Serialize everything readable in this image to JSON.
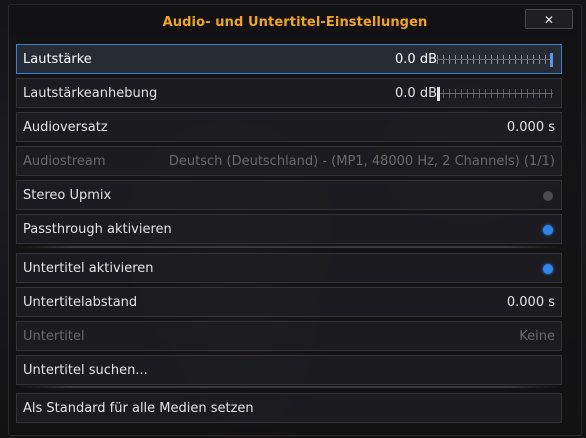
{
  "dialog": {
    "title": "Audio- und Untertitel-Einstellungen",
    "close_label": "✕"
  },
  "rows": [
    {
      "label": "Lautstärke",
      "value": "0.0 dB",
      "slider_level": 1.0
    },
    {
      "label": "Lautstärkeanhebung",
      "value": "0.0 dB",
      "slider_level": 0.0
    },
    {
      "label": "Audioversatz",
      "value": "0.000 s"
    },
    {
      "label": "Audiostream",
      "value": "Deutsch (Deutschland) - (MP1, 48000 Hz, 2 Channels) (1/1)"
    },
    {
      "label": "Stereo Upmix",
      "toggle": "off"
    },
    {
      "label": "Passthrough aktivieren",
      "toggle": "on"
    },
    {
      "label": "Untertitel aktivieren",
      "toggle": "on"
    },
    {
      "label": "Untertitelabstand",
      "value": "0.000 s"
    },
    {
      "label": "Untertitel",
      "value": "Keine"
    },
    {
      "label": "Untertitel suchen..."
    },
    {
      "label": "Als Standard für alle Medien setzen"
    }
  ],
  "colors": {
    "title": "#f0a520",
    "focus_border": "#3d7ed1",
    "toggle_on": "#2f86ea"
  }
}
